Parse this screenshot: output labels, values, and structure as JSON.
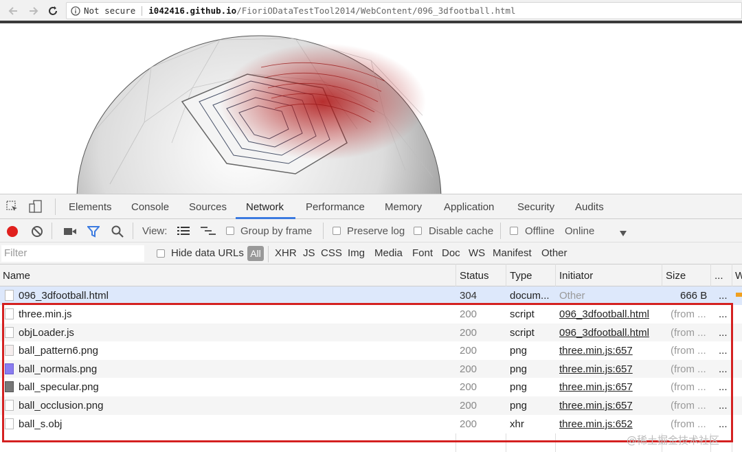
{
  "browser": {
    "security_label": "Not secure",
    "url_host": "i042416.github.io",
    "url_path": "/FioriODataTestTool2014/WebContent/096_3dfootball.html"
  },
  "devtools": {
    "tabs": [
      {
        "label": "Elements"
      },
      {
        "label": "Console"
      },
      {
        "label": "Sources"
      },
      {
        "label": "Network"
      },
      {
        "label": "Performance"
      },
      {
        "label": "Memory"
      },
      {
        "label": "Application"
      },
      {
        "label": "Security"
      },
      {
        "label": "Audits"
      }
    ],
    "active_tab": "Network",
    "toolbar": {
      "view_label": "View:",
      "group_by_frame": "Group by frame",
      "preserve_log": "Preserve log",
      "disable_cache": "Disable cache",
      "offline": "Offline",
      "throttle": "Online"
    },
    "filter": {
      "placeholder": "Filter",
      "hide_data_urls": "Hide data URLs",
      "types": [
        "All",
        "XHR",
        "JS",
        "CSS",
        "Img",
        "Media",
        "Font",
        "Doc",
        "WS",
        "Manifest",
        "Other"
      ]
    },
    "grid": {
      "columns": [
        "Name",
        "Status",
        "Type",
        "Initiator",
        "Size",
        "...",
        "W"
      ],
      "rows": [
        {
          "name": "096_3dfootball.html",
          "status": "304",
          "type": "docum...",
          "initiator": "Other",
          "size": "666 B",
          "more": "..."
        },
        {
          "name": "three.min.js",
          "status": "200",
          "type": "script",
          "initiator": "096_3dfootball.html",
          "size": "(from ...",
          "more": "..."
        },
        {
          "name": "objLoader.js",
          "status": "200",
          "type": "script",
          "initiator": "096_3dfootball.html",
          "size": "(from ...",
          "more": "..."
        },
        {
          "name": "ball_pattern6.png",
          "status": "200",
          "type": "png",
          "initiator": "three.min.js:657",
          "size": "(from ...",
          "more": "..."
        },
        {
          "name": "ball_normals.png",
          "status": "200",
          "type": "png",
          "initiator": "three.min.js:657",
          "size": "(from ...",
          "more": "..."
        },
        {
          "name": "ball_specular.png",
          "status": "200",
          "type": "png",
          "initiator": "three.min.js:657",
          "size": "(from ...",
          "more": "..."
        },
        {
          "name": "ball_occlusion.png",
          "status": "200",
          "type": "png",
          "initiator": "three.min.js:657",
          "size": "(from ...",
          "more": "..."
        },
        {
          "name": "ball_s.obj",
          "status": "200",
          "type": "xhr",
          "initiator": "three.min.js:652",
          "size": "(from ...",
          "more": "..."
        }
      ]
    }
  },
  "watermark": "@稀土掘金技术社区",
  "colors": {
    "accent": "#3b7ae0",
    "record": "#e0201d",
    "highlight": "#d42020"
  }
}
